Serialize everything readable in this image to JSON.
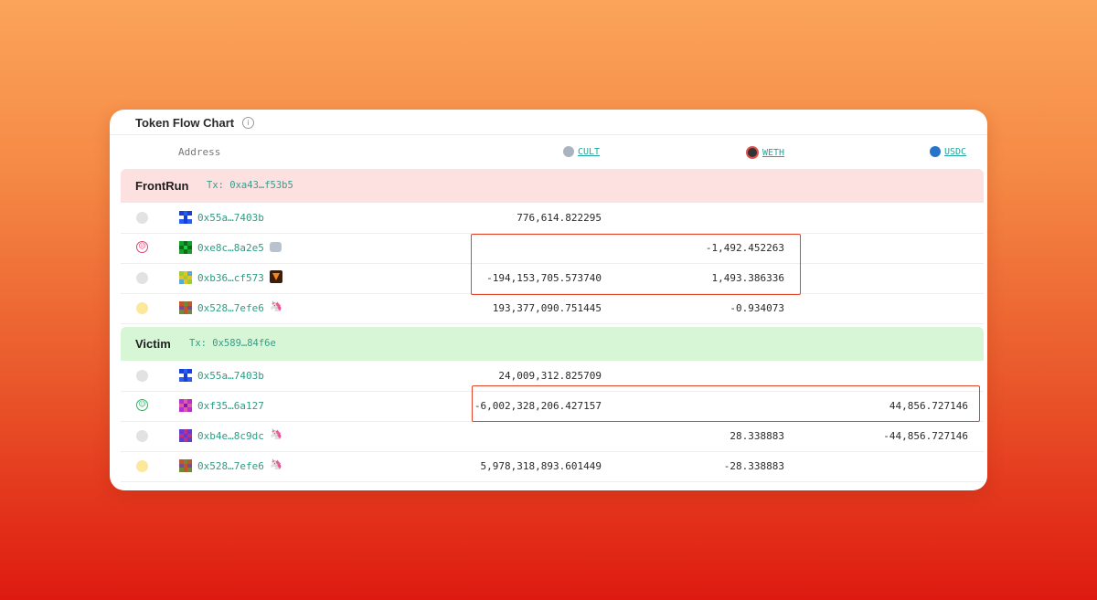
{
  "title": "Token Flow Chart",
  "header": {
    "address_label": "Address",
    "tokens": [
      {
        "symbol": "CULT",
        "icon": "cult-token-icon",
        "color": "#a9b4bf"
      },
      {
        "symbol": "WETH",
        "icon": "weth-token-icon",
        "color": "#333333"
      },
      {
        "symbol": "USDC",
        "icon": "usdc-token-icon",
        "color": "#2775ca"
      }
    ]
  },
  "sections": [
    {
      "name": "FrontRun",
      "tx": "Tx: 0xa43…f53b5",
      "bg": "#fde1e1",
      "rows": [
        {
          "address": "0x55a…7403b",
          "cult": "776,614.822295",
          "weth": "",
          "usdc": ""
        },
        {
          "address": "0xe8c…8a2e5",
          "tag": "robot-icon",
          "cult": "",
          "weth": "-1,492.452263",
          "usdc": ""
        },
        {
          "address": "0xb36…cf573",
          "tag": "metamask-fox-icon",
          "cult": "-194,153,705.573740",
          "weth": "1,493.386336",
          "usdc": ""
        },
        {
          "address": "0x528…7efe6",
          "tag": "unicorn-icon",
          "cult": "193,377,090.751445",
          "weth": "-0.934073",
          "usdc": ""
        }
      ]
    },
    {
      "name": "Victim",
      "tx": "Tx: 0x589…84f6e",
      "bg": "#d6f6d6",
      "rows": [
        {
          "address": "0x55a…7403b",
          "cult": "24,009,312.825709",
          "weth": "",
          "usdc": ""
        },
        {
          "address": "0xf35…6a127",
          "cult": "-6,002,328,206.427157",
          "weth": "",
          "usdc": "44,856.727146"
        },
        {
          "address": "0xb4e…8c9dc",
          "tag": "unicorn-icon",
          "cult": "",
          "weth": "28.338883",
          "usdc": "-44,856.727146"
        },
        {
          "address": "0x528…7efe6",
          "tag": "unicorn-icon",
          "cult": "5,978,318,893.601449",
          "weth": "-28.338883",
          "usdc": ""
        }
      ]
    }
  ],
  "colors": {
    "highlight": "#e3452a",
    "address_link": "#2f9c84",
    "token_link": "#1fa7a0"
  }
}
